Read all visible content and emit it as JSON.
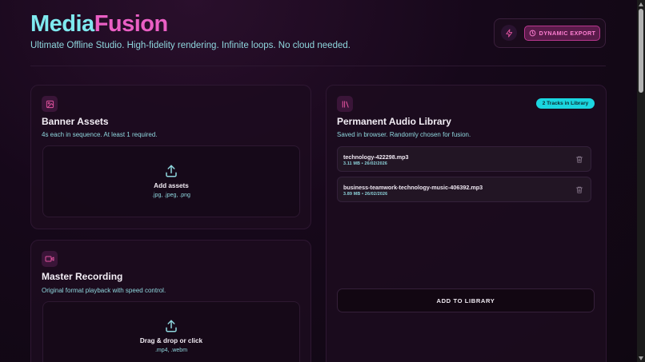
{
  "header": {
    "logo_part1": "Media",
    "logo_part2": "Fusion",
    "tagline": "Ultimate Offline Studio. High-fidelity rendering. Infinite loops. No cloud needed.",
    "export_label": "DYNAMIC EXPORT"
  },
  "banner_assets": {
    "title": "Banner Assets",
    "subtitle": "4s each in sequence. At least 1 required.",
    "drop_title": "Add assets",
    "drop_formats": ".jpg, .jpeg, .png"
  },
  "master_recording": {
    "title": "Master Recording",
    "subtitle": "Original format playback with speed control.",
    "drop_title": "Drag & drop or click",
    "drop_formats": ".mp4, .webm"
  },
  "audio_library": {
    "title": "Permanent Audio Library",
    "subtitle": "Saved in browser. Randomly chosen for fusion.",
    "badge": "2 Tracks in Library",
    "tracks": [
      {
        "name": "technology-422298.mp3",
        "meta": "3.11 MB • 26/02/2026"
      },
      {
        "name": "business-teamwork-technology-music-406392.mp3",
        "meta": "3.89 MB • 26/02/2026"
      }
    ],
    "add_label": "ADD TO LIBRARY"
  },
  "colors": {
    "accent_cyan": "#7fe9ef",
    "accent_pink": "#ea5fc4",
    "badge_cyan": "#1bd6e0"
  },
  "icons": {
    "bolt": "bolt-icon",
    "clock": "clock-icon",
    "image": "image-icon",
    "library": "library-icon",
    "video": "video-camera-icon",
    "upload": "upload-icon",
    "trash": "trash-icon"
  }
}
